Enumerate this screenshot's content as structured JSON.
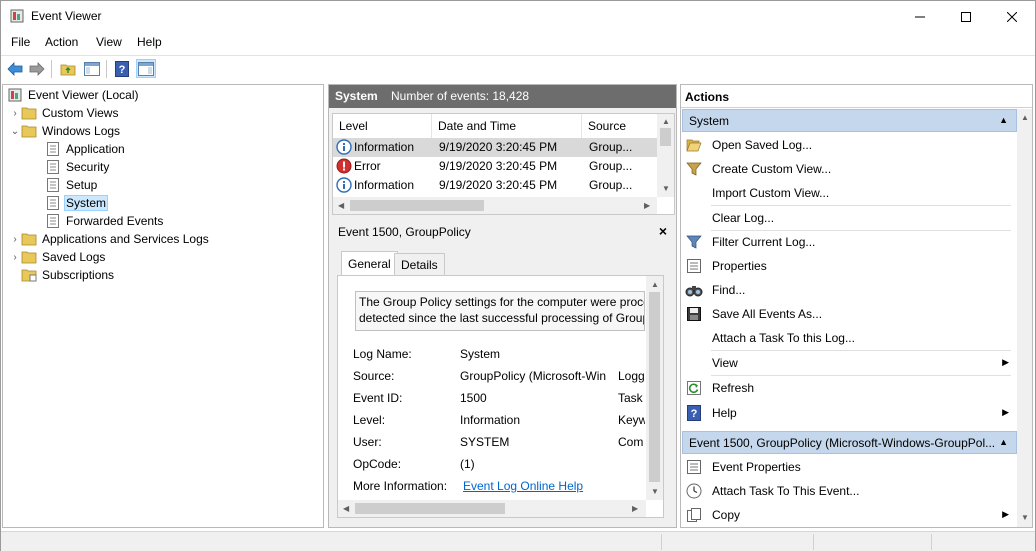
{
  "window": {
    "title": "Event Viewer"
  },
  "menu": [
    "File",
    "Action",
    "View",
    "Help"
  ],
  "tree": {
    "items": [
      {
        "label": "Event Viewer (Local)",
        "icon": "event-viewer-icon",
        "expand": "expanded"
      },
      {
        "label": "Custom Views",
        "icon": "folder-icon",
        "expand": "collapsed"
      },
      {
        "label": "Windows Logs",
        "icon": "folder-icon",
        "expand": "expanded"
      },
      {
        "label": "Application",
        "icon": "log-icon",
        "expand": "none"
      },
      {
        "label": "Security",
        "icon": "log-icon",
        "expand": "none"
      },
      {
        "label": "Setup",
        "icon": "log-icon",
        "expand": "none"
      },
      {
        "label": "System",
        "icon": "log-icon",
        "expand": "none",
        "selected": true
      },
      {
        "label": "Forwarded Events",
        "icon": "log-icon",
        "expand": "none"
      },
      {
        "label": "Applications and Services Logs",
        "icon": "folder-icon",
        "expand": "collapsed"
      },
      {
        "label": "Saved Logs",
        "icon": "folder-icon",
        "expand": "collapsed"
      },
      {
        "label": "Subscriptions",
        "icon": "subscriptions-icon",
        "expand": "none"
      }
    ]
  },
  "log": {
    "name": "System",
    "count_label": "Number of events: 18,428",
    "columns": [
      "Level",
      "Date and Time",
      "Source"
    ],
    "rows": [
      {
        "level": "Information",
        "icon": "info-icon",
        "datetime": "9/19/2020 3:20:45 PM",
        "source": "Group..."
      },
      {
        "level": "Error",
        "icon": "error-icon",
        "datetime": "9/19/2020 3:20:45 PM",
        "source": "Group..."
      },
      {
        "level": "Information",
        "icon": "info-icon",
        "datetime": "9/19/2020 3:20:45 PM",
        "source": "Group..."
      }
    ]
  },
  "detail": {
    "title": "Event 1500, GroupPolicy",
    "close": "×",
    "tabs": [
      "General",
      "Details"
    ],
    "description_lines": [
      "The Group Policy settings for the computer were proce",
      "detected since the last successful processing of Group"
    ],
    "props": [
      {
        "key": "Log Name:",
        "value": "System",
        "right": ""
      },
      {
        "key": "Source:",
        "value": "GroupPolicy (Microsoft-Win",
        "right": "Logg"
      },
      {
        "key": "Event ID:",
        "value": "1500",
        "right": "Task"
      },
      {
        "key": "Level:",
        "value": "Information",
        "right": "Keyw"
      },
      {
        "key": "User:",
        "value": "SYSTEM",
        "right": "Com"
      },
      {
        "key": "OpCode:",
        "value": "(1)",
        "right": ""
      }
    ],
    "more_info_key": "More Information:",
    "more_info_link": "Event Log Online Help"
  },
  "actions": {
    "header": "Actions",
    "section1": "System",
    "items1": [
      {
        "label": "Open Saved Log...",
        "icon": "open-folder-icon"
      },
      {
        "label": "Create Custom View...",
        "icon": "filter-icon"
      },
      {
        "label": "Import Custom View...",
        "icon": ""
      },
      {
        "label": "Clear Log...",
        "icon": ""
      },
      {
        "label": "Filter Current Log...",
        "icon": "filter-icon"
      },
      {
        "label": "Properties",
        "icon": "properties-icon"
      },
      {
        "label": "Find...",
        "icon": "binoculars-icon"
      },
      {
        "label": "Save All Events As...",
        "icon": "save-icon"
      },
      {
        "label": "Attach a Task To this Log...",
        "icon": ""
      },
      {
        "label": "View",
        "icon": "",
        "submenu": true
      },
      {
        "label": "Refresh",
        "icon": "refresh-icon"
      },
      {
        "label": "Help",
        "icon": "help-icon",
        "submenu": true
      }
    ],
    "section2": "Event 1500, GroupPolicy (Microsoft-Windows-GroupPol...",
    "items2": [
      {
        "label": "Event Properties",
        "icon": "properties-icon"
      },
      {
        "label": "Attach Task To This Event...",
        "icon": "task-icon"
      },
      {
        "label": "Copy",
        "icon": "copy-icon",
        "submenu": true
      }
    ]
  }
}
